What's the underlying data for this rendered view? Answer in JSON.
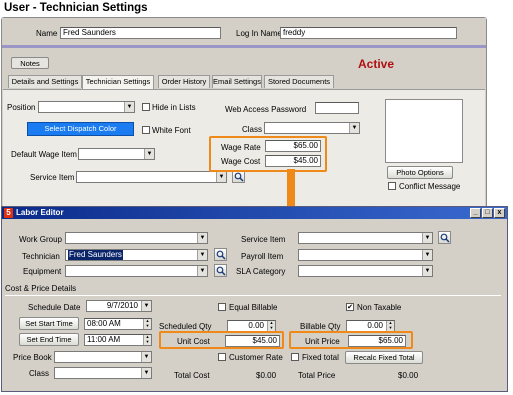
{
  "page_title": "User - Technician Settings",
  "top": {
    "name_label": "Name",
    "name_value": "Fred Saunders",
    "login_label": "Log In Name",
    "login_value": "freddy",
    "notes_button": "Notes",
    "status": "Active",
    "tabs": [
      "Details and Settings",
      "Technician Settings",
      "Order History",
      "Email Settings",
      "Stored Documents"
    ],
    "position_label": "Position",
    "hide_in_lists": "Hide in Lists",
    "select_dispatch_color": "Select Dispatch Color",
    "white_font": "White Font",
    "default_wage_item_label": "Default Wage Item",
    "service_item_label": "Service Item",
    "web_access_password_label": "Web Access Password",
    "class_label": "Class",
    "wage_rate_label": "Wage Rate",
    "wage_rate_value": "$65.00",
    "wage_cost_label": "Wage Cost",
    "wage_cost_value": "$45.00",
    "photo_options": "Photo Options",
    "conflict_message": "Conflict Message"
  },
  "labor": {
    "title": "Labor Editor",
    "window_controls": [
      "_",
      "□",
      "x"
    ],
    "work_group_label": "Work Group",
    "technician_label": "Technician",
    "technician_value": "Fred Saunders",
    "equipment_label": "Equipment",
    "service_item_label": "Service Item",
    "payroll_item_label": "Payroll Item",
    "sla_category_label": "SLA Category",
    "cost_price_section": "Cost & Price Details",
    "schedule_date_label": "Schedule Date",
    "schedule_date_value": "9/7/2010",
    "set_start_time": "Set Start Time",
    "start_time_value": "08:00 AM",
    "set_end_time": "Set End Time",
    "end_time_value": "11:00 AM",
    "price_book_label": "Price Book",
    "class_label": "Class",
    "equal_billable": "Equal Billable",
    "non_taxable": "Non Taxable",
    "non_taxable_checked": "✔",
    "scheduled_qty_label": "Scheduled Qty",
    "scheduled_qty_value": "0.00",
    "billable_qty_label": "Billable Qty",
    "billable_qty_value": "0.00",
    "unit_cost_label": "Unit Cost",
    "unit_cost_value": "$45.00",
    "unit_price_label": "Unit Price",
    "unit_price_value": "$65.00",
    "customer_rate": "Customer Rate",
    "fixed_total": "Fixed total",
    "recalc_fixed_total": "Recalc Fixed Total",
    "total_cost_label": "Total Cost",
    "total_cost_value": "$0.00",
    "total_price_label": "Total Price",
    "total_price_value": "$0.00"
  },
  "colors": {
    "highlight": "#ef8a1a",
    "status_red": "#b01010",
    "dispatch_blue": "#1a7cf0",
    "title_bar": "#0a2a8a"
  }
}
